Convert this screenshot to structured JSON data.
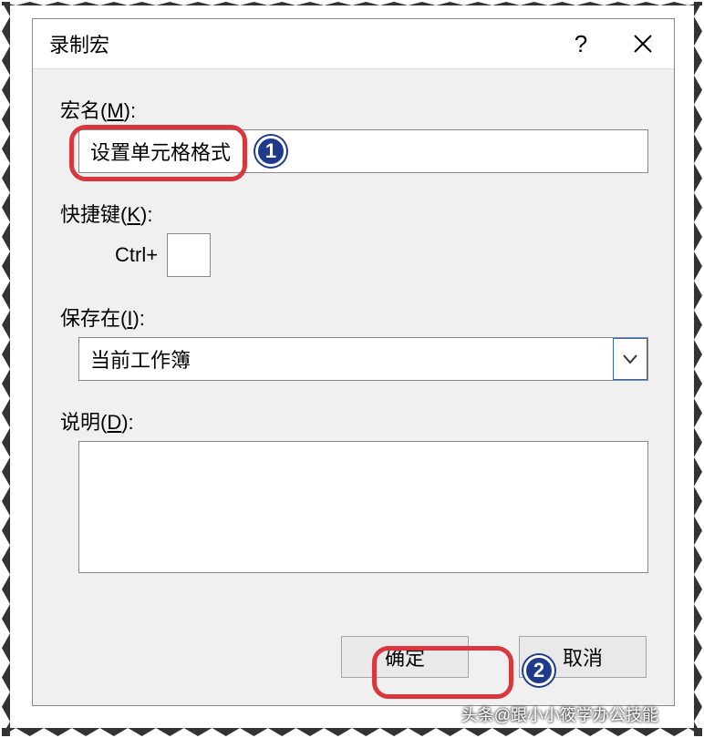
{
  "dialog": {
    "title": "录制宏",
    "help_symbol": "?",
    "close_label": "关闭"
  },
  "fields": {
    "macro_name": {
      "label": "宏名(",
      "mnemonic": "M",
      "label_end": "):",
      "value": "设置单元格格式"
    },
    "shortcut": {
      "label": "快捷键(",
      "mnemonic": "K",
      "label_end": "):",
      "prefix": "Ctrl+",
      "value": ""
    },
    "save_in": {
      "label": "保存在(",
      "mnemonic": "I",
      "label_end": "):",
      "value": "当前工作簿"
    },
    "description": {
      "label": "说明(",
      "mnemonic": "D",
      "label_end": "):",
      "value": ""
    }
  },
  "buttons": {
    "ok": "确定",
    "cancel": "取消"
  },
  "annotations": {
    "badge1": "1",
    "badge2": "2"
  },
  "watermark": "头条@跟小小筱学办公技能"
}
